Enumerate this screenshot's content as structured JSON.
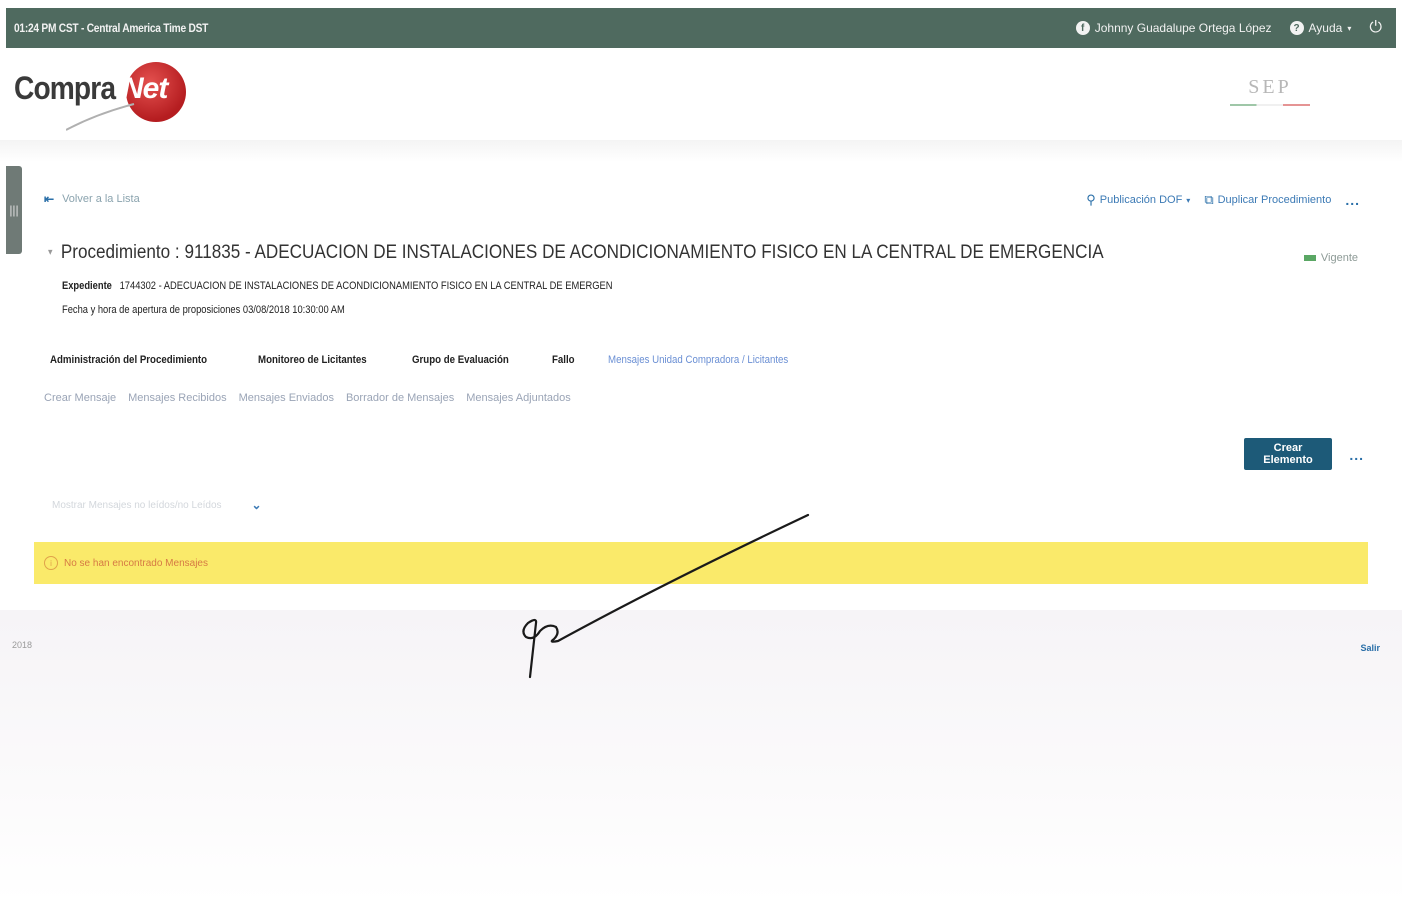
{
  "topbar": {
    "time": "01:24 PM CST - Central America Time DST",
    "user": "Johnny Guadalupe Ortega López",
    "help": "Ayuda",
    "user_icon": "facebook-circle-icon",
    "help_icon": "question-circle-icon",
    "power_icon": "power-icon"
  },
  "header": {
    "logo_text": "Compra",
    "logo_ball_text": "Net",
    "sep_logo": "SEP"
  },
  "nav": {
    "back": "Volver a la Lista",
    "actions": [
      "Publicación DOF",
      "Duplicar Procedimiento"
    ],
    "more": "..."
  },
  "procedure": {
    "title": "Procedimiento : 911835 - ADECUACION DE INSTALACIONES DE ACONDICIONAMIENTO FISICO EN LA CENTRAL DE EMERGENCIA",
    "status": "Vigente",
    "expediente_label": "Expediente",
    "expediente_value": "1744302 - ADECUACION DE INSTALACIONES DE ACONDICIONAMIENTO FISICO EN LA CENTRAL DE EMERGEN",
    "fecha_label": "Fecha y hora de apertura de proposiciones",
    "fecha_value": "03/08/2018 10:30:00 AM"
  },
  "tabs": [
    {
      "label": "Administración del Procedimiento",
      "active": false
    },
    {
      "label": "Monitoreo de Licitantes",
      "active": false
    },
    {
      "label": "Grupo de Evaluación",
      "active": false
    },
    {
      "label": "Fallo",
      "active": false
    },
    {
      "label": "Mensajes Unidad Compradora / Licitantes",
      "active": true
    }
  ],
  "subtabs": [
    "Crear Mensaje",
    "Mensajes Recibidos",
    "Mensajes Enviados",
    "Borrador de Mensajes",
    "Mensajes Adjuntados"
  ],
  "toolbar": {
    "create_label": "Crear Elemento",
    "more": "..."
  },
  "filter": {
    "text": "Mostrar Mensajes no leídos/no Leídos"
  },
  "alert": {
    "text": "No se han encontrado Mensajes"
  },
  "footer": {
    "left": "2018",
    "right": "Salir"
  },
  "colors": {
    "topbar": "#4f6a5f",
    "primary_button": "#1d5a78",
    "alert_bg": "#faea6a",
    "link": "#3c7ab5"
  }
}
